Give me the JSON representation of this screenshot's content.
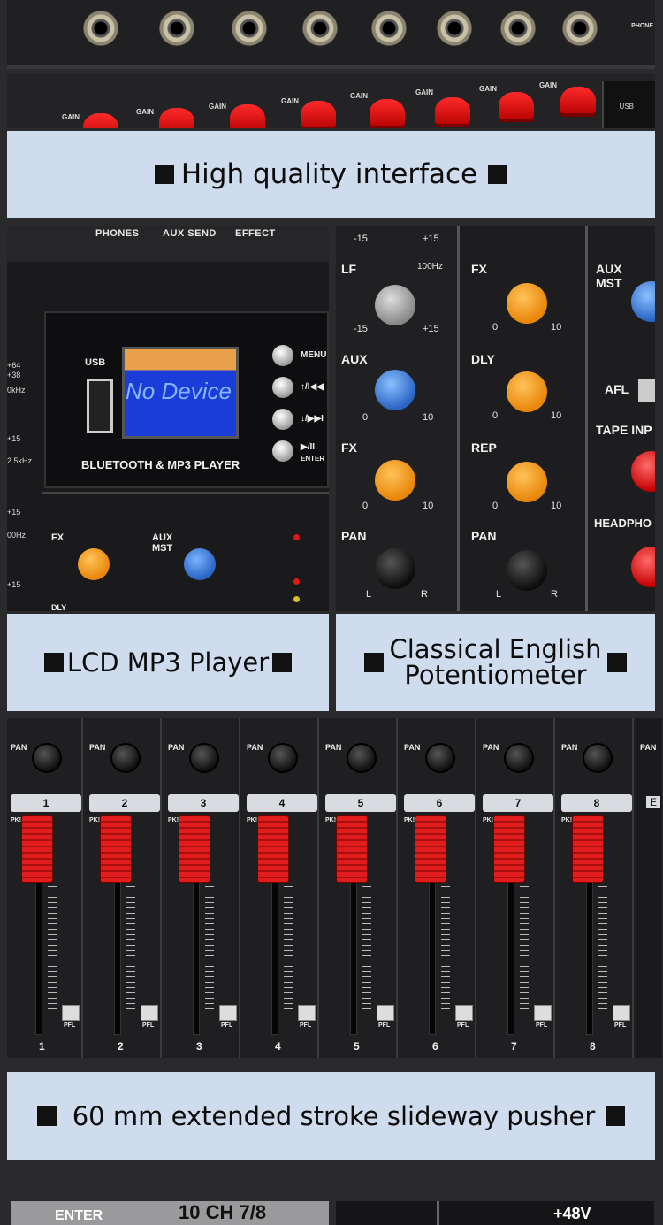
{
  "captions": {
    "interface": "High quality interface",
    "lcd": "LCD MP3 Player",
    "pot_line1": "Classical English",
    "pot_line2": "Potentiometer",
    "fader": "60 mm extended stroke slideway pusher"
  },
  "panel1": {
    "gain_label": "GAIN",
    "usb_label": "USB",
    "phones_label": "PHONE"
  },
  "panel2": {
    "top_labels": [
      "PHONES",
      "AUX SEND",
      "EFFECT"
    ],
    "lcd_text": "No Device",
    "usb_label": "USB",
    "player_label": "BLUETOOTH & MP3 PLAYER",
    "buttons": [
      "MENU",
      "↑/I◀◀",
      "↓/▶▶I",
      "▶/II"
    ],
    "enter_label": "ENTER",
    "scale_labels": [
      "+64",
      "+38",
      "0kHz",
      "+15",
      "2.5kHz",
      "+15",
      "00Hz",
      "+15"
    ],
    "fx_label": "FX",
    "aux_mst_label": "AUX MST",
    "dly_label": "DLY"
  },
  "panel3": {
    "strip1": [
      "LF",
      "AUX",
      "FX",
      "PAN"
    ],
    "strip2": [
      "FX",
      "DLY",
      "REP",
      "PAN"
    ],
    "strip3": [
      "AUX MST",
      "AFL",
      "TAPE INP",
      "HEADPHO"
    ],
    "freq_label": "100Hz",
    "minus15": "-15",
    "plus15": "+15",
    "zero": "0",
    "ten": "10",
    "l": "L",
    "r": "R"
  },
  "panel4": {
    "pan_label": "PAN",
    "pk_label": "PK!",
    "pfl_label": "PFL",
    "channels": [
      "1",
      "2",
      "3",
      "4",
      "5",
      "6",
      "7",
      "8"
    ],
    "extra": "E"
  },
  "panel5": {
    "enter": "ENTER",
    "ch_label": "10 CH 7/8",
    "phantom": "+48V"
  },
  "colors": {
    "caption_bg": "#cfdcee",
    "knob_orange": "#f39a1c",
    "knob_blue": "#3b7fd8",
    "knob_gray": "#9a9a9a",
    "knob_red": "#e01c1c",
    "fader_red": "#e01c1c"
  }
}
